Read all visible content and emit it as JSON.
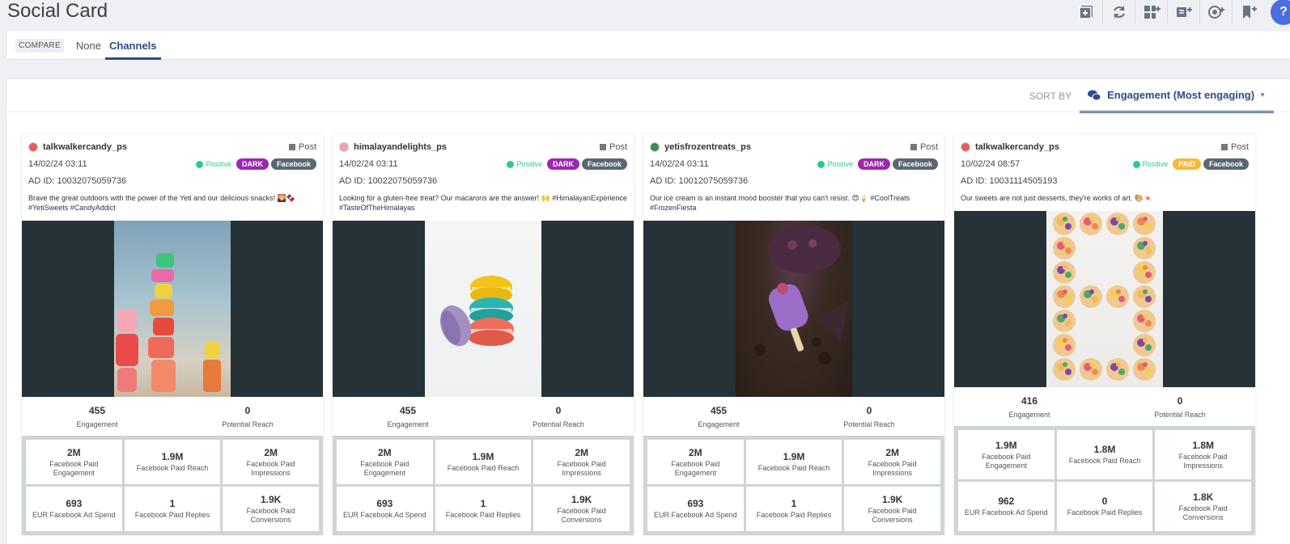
{
  "page": {
    "title": "Social Card"
  },
  "toolbar": {
    "icons": [
      "add-widget-icon",
      "refresh-icon",
      "add-dashboard-icon",
      "add-report-icon",
      "add-alert-icon",
      "bookmark-add-icon"
    ],
    "help_label": "?"
  },
  "compare": {
    "tag": "COMPARE",
    "options": [
      "None",
      "Channels"
    ],
    "active": "Channels"
  },
  "sort": {
    "label": "SORT BY",
    "value": "Engagement (Most engaging)"
  },
  "colors": {
    "accent": "#2d4a8a",
    "positive": "#2ecc8b",
    "dark_badge": "#9c27b0",
    "paid_badge": "#f6b93b",
    "channel_badge": "#5b6770",
    "media_bg": "#263238"
  },
  "cards": [
    {
      "author": "talkwalkercandy_ps",
      "post_type": "Post",
      "date": "14/02/24 03:11",
      "sentiment": "Positive",
      "ad_type": "DARK",
      "ad_type_color": "#9c27b0",
      "channel": "Facebook",
      "ad_id": "AD ID: 10032075059736",
      "text": "Brave the great outdoors with the power of the Yeti and our delicious snacks! 🌄🍫 #YetiSweets #CandyAddict",
      "image": "rock-towers",
      "engagement": "455",
      "engagement_label": "Engagement",
      "reach": "0",
      "reach_label": "Potential Reach",
      "stats": [
        {
          "value": "2M",
          "label": "Facebook Paid Engagement"
        },
        {
          "value": "1.9M",
          "label": "Facebook Paid Reach"
        },
        {
          "value": "2M",
          "label": "Facebook Paid Impressions"
        },
        {
          "value": "693",
          "label": "EUR Facebook Ad Spend"
        },
        {
          "value": "1",
          "label": "Facebook Paid Replies"
        },
        {
          "value": "1.9K",
          "label": "Facebook Paid Conversions"
        }
      ]
    },
    {
      "author": "himalayandelights_ps",
      "post_type": "Post",
      "date": "14/02/24 03:11",
      "sentiment": "Positive",
      "ad_type": "DARK",
      "ad_type_color": "#9c27b0",
      "channel": "Facebook",
      "ad_id": "AD ID: 10022075059736",
      "text": "Looking for a gluten-free treat? Our macarons are the answer! 🙌 #HimalayanExperience #TasteOfTheHimalayas",
      "image": "macarons",
      "engagement": "455",
      "engagement_label": "Engagement",
      "reach": "0",
      "reach_label": "Potential Reach",
      "stats": [
        {
          "value": "2M",
          "label": "Facebook Paid Engagement"
        },
        {
          "value": "1.9M",
          "label": "Facebook Paid Reach"
        },
        {
          "value": "2M",
          "label": "Facebook Paid Impressions"
        },
        {
          "value": "693",
          "label": "EUR Facebook Ad Spend"
        },
        {
          "value": "1",
          "label": "Facebook Paid Replies"
        },
        {
          "value": "1.9K",
          "label": "Facebook Paid Conversions"
        }
      ]
    },
    {
      "author": "yetisfrozentreats_ps",
      "post_type": "Post",
      "date": "14/02/24 03:11",
      "sentiment": "Positive",
      "ad_type": "DARK",
      "ad_type_color": "#9c27b0",
      "channel": "Facebook",
      "ad_id": "AD ID: 10012075059736",
      "text": "Our ice cream is an instant mood booster that you can't resist. 😍🍦 #CoolTreats #FrozenFiesta",
      "image": "ice-cream",
      "engagement": "455",
      "engagement_label": "Engagement",
      "reach": "0",
      "reach_label": "Potential Reach",
      "stats": [
        {
          "value": "2M",
          "label": "Facebook Paid Engagement"
        },
        {
          "value": "1.9M",
          "label": "Facebook Paid Reach"
        },
        {
          "value": "2M",
          "label": "Facebook Paid Impressions"
        },
        {
          "value": "693",
          "label": "EUR Facebook Ad Spend"
        },
        {
          "value": "1",
          "label": "Facebook Paid Replies"
        },
        {
          "value": "1.9K",
          "label": "Facebook Paid Conversions"
        }
      ]
    },
    {
      "author": "talkwalkercandy_ps",
      "post_type": "Post",
      "date": "10/02/24 08:57",
      "sentiment": "Positive",
      "ad_type": "PAID",
      "ad_type_color": "#f6b93b",
      "channel": "Facebook",
      "ad_id": "AD ID: 10031114505193",
      "text": "Our sweets are not just desserts, they're works of art. 🎨🍬",
      "image": "tarts",
      "engagement": "416",
      "engagement_label": "Engagement",
      "reach": "0",
      "reach_label": "Potential Reach",
      "stats": [
        {
          "value": "1.9M",
          "label": "Facebook Paid Engagement"
        },
        {
          "value": "1.8M",
          "label": "Facebook Paid Reach"
        },
        {
          "value": "1.8M",
          "label": "Facebook Paid Impressions"
        },
        {
          "value": "962",
          "label": "EUR Facebook Ad Spend"
        },
        {
          "value": "0",
          "label": "Facebook Paid Replies"
        },
        {
          "value": "1.8K",
          "label": "Facebook Paid Conversions"
        }
      ]
    }
  ]
}
